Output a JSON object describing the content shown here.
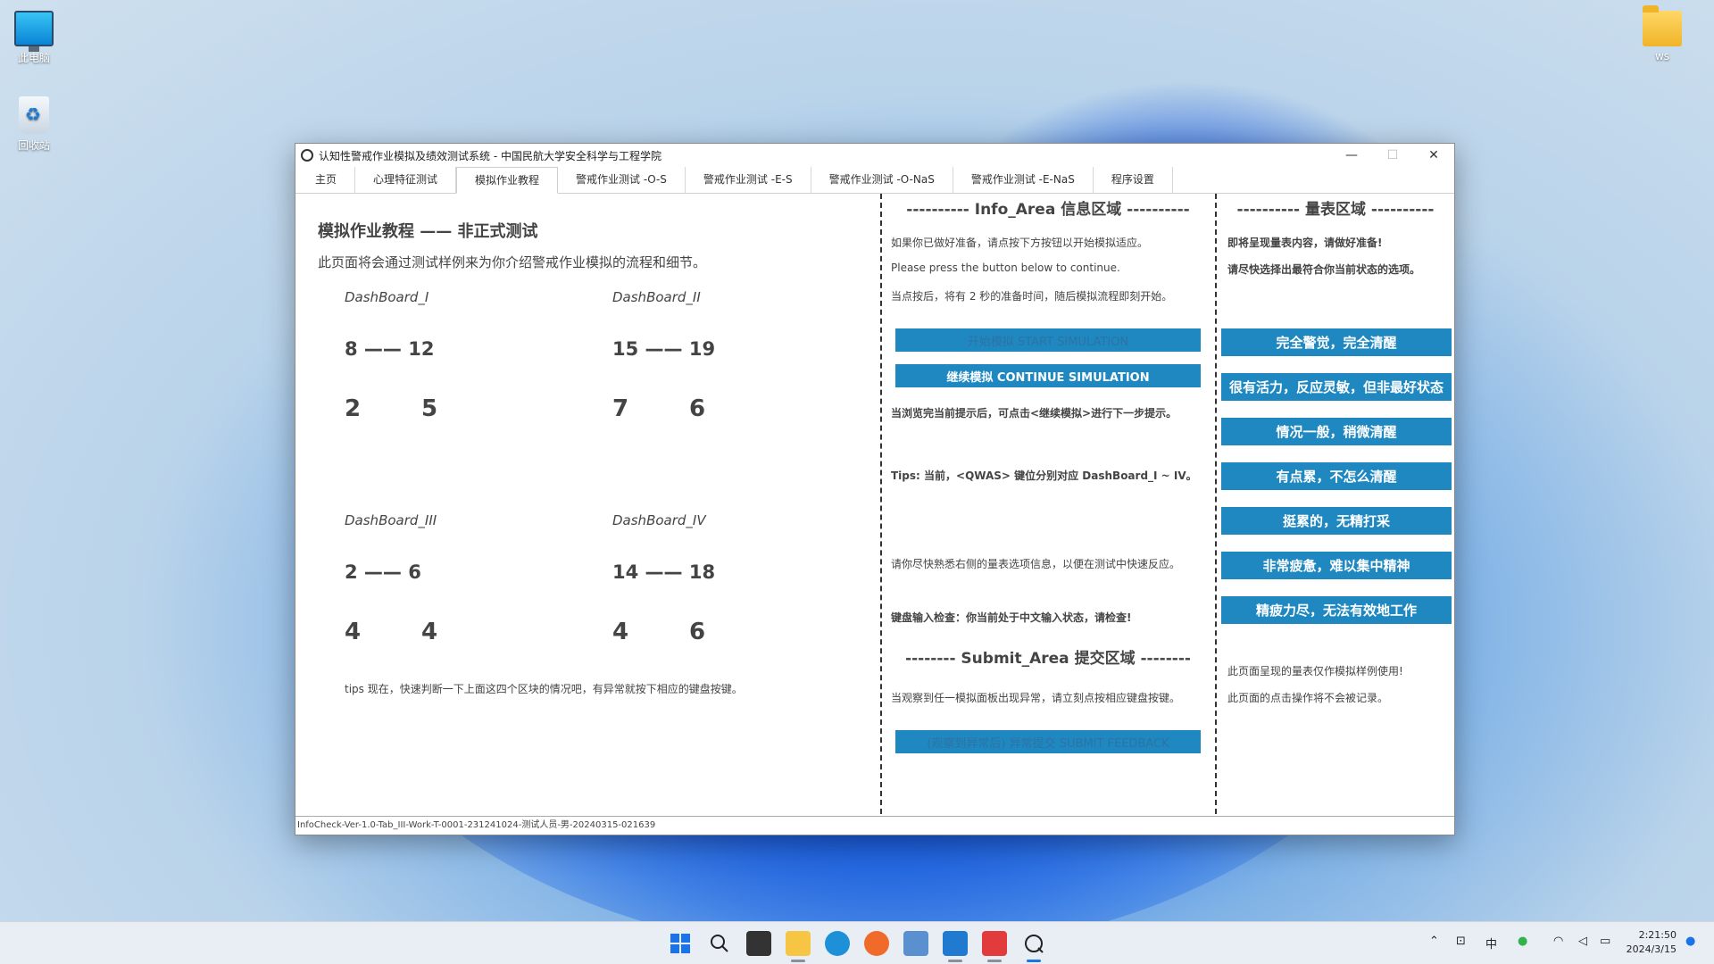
{
  "desktop": {
    "icons": [
      {
        "label": "此电脑"
      },
      {
        "label": "回收站"
      },
      {
        "label": "ws"
      }
    ]
  },
  "window": {
    "title": "认知性警戒作业模拟及绩效测试系统 - 中国民航大学安全科学与工程学院",
    "minimize_glyph": "—",
    "maximize_glyph": "☐",
    "close_glyph": "✕"
  },
  "tabs": [
    {
      "label": "主页"
    },
    {
      "label": "心理特征测试"
    },
    {
      "label": "模拟作业教程"
    },
    {
      "label": "警戒作业测试 -O-S"
    },
    {
      "label": "警戒作业测试 -E-S"
    },
    {
      "label": "警戒作业测试 -O-NaS"
    },
    {
      "label": "警戒作业测试 -E-NaS"
    },
    {
      "label": "程序设置"
    }
  ],
  "active_tab": "模拟作业教程",
  "tutorial": {
    "title": "模拟作业教程 —— 非正式测试",
    "description": "此页面将会通过测试样例来为你介绍警戒作业模拟的流程和细节。",
    "dashboards": [
      {
        "name": "DashBoard_I",
        "range": "8 —— 12",
        "v1": "2",
        "v2": "5"
      },
      {
        "name": "DashBoard_II",
        "range": "15 —— 19",
        "v1": "7",
        "v2": "6"
      },
      {
        "name": "DashBoard_III",
        "range": "2 —— 6",
        "v1": "4",
        "v2": "4"
      },
      {
        "name": "DashBoard_IV",
        "range": "14 —— 18",
        "v1": "4",
        "v2": "6"
      }
    ],
    "tips": "tips 现在，快速判断一下上面这四个区块的情况吧，有异常就按下相应的键盘按键。"
  },
  "info_area": {
    "header": "---------- Info_Area  信息区域 ----------",
    "line1": "如果你已做好准备，请点按下方按钮以开始模拟适应。",
    "line2": "Please press the button below to continue.",
    "line3": "当点按后，将有 2 秒的准备时间，随后模拟流程即刻开始。",
    "start_button": "开始模拟  START SIMULATION",
    "continue_button": "继续模拟  CONTINUE SIMULATION",
    "line4": "当浏览完当前提示后，可点击<继续模拟>进行下一步提示。",
    "line5": "Tips:  当前，<QWAS> 键位分别对应 DashBoard_I ~ IV。",
    "line6": "请你尽快熟悉右侧的量表选项信息，以便在测试中快速反应。",
    "line7": "键盘输入检查：你当前处于中文输入状态，请检查!"
  },
  "submit_area": {
    "header": "-------- Submit_Area  提交区域 --------",
    "line1": "当观察到任一模拟面板出现异常，请立刻点按相应键盘按键。",
    "submit_button": "(观察到异常后) 异常提交  SUBMIT FEEDBACK"
  },
  "scale_area": {
    "header": "---------- 量表区域 ----------",
    "line1": "即将呈现量表内容，请做好准备!",
    "line2": "请尽快选择出最符合你当前状态的选项。",
    "options": [
      "完全警觉，完全清醒",
      "很有活力，反应灵敏，但非最好状态",
      "情况一般，稍微清醒",
      "有点累，不怎么清醒",
      "挺累的，无精打采",
      "非常疲惫，难以集中精神",
      "精疲力尽，无法有效地工作"
    ],
    "note1": "此页面呈现的量表仅作模拟样例使用!",
    "note2": "此页面的点击操作将不会被记录。"
  },
  "status_bar": "InfoCheck-Ver-1.0-Tab_III-Work-T-0001-231241024-测试人员-男-20240315-021639",
  "taskbar": {
    "tray_ime": "中",
    "time": "2:21:50",
    "date": "2024/3/15"
  },
  "colors": {
    "accent_button": "#1f88c1",
    "text": "#444444"
  }
}
